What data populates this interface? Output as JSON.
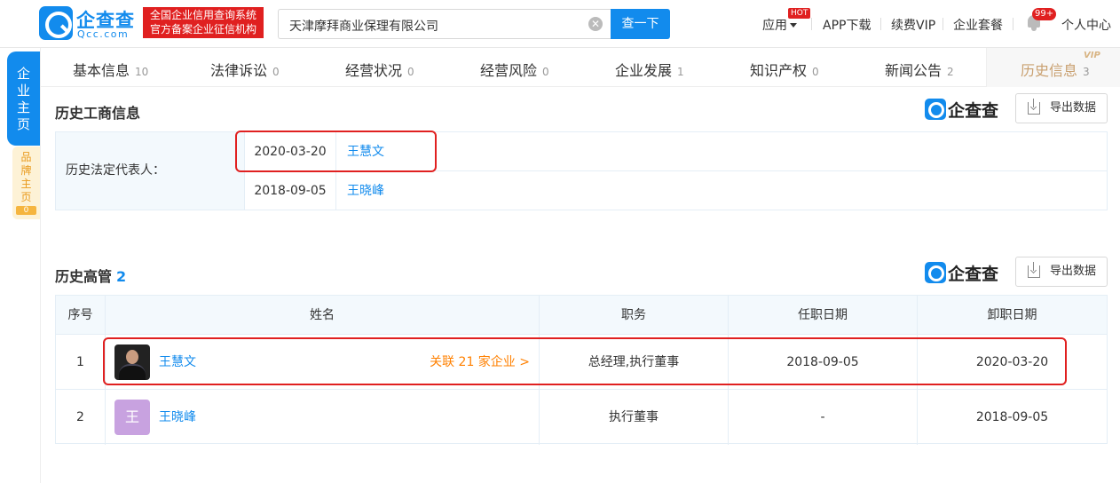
{
  "header": {
    "logo_title": "企查查",
    "logo_sub": "Qcc.com",
    "slogan_line1": "全国企业信用查询系统",
    "slogan_line2": "官方备案企业征信机构",
    "search_value": "天津摩拜商业保理有限公司",
    "search_button": "查一下",
    "nav": {
      "apps": "应用",
      "hot": "HOT",
      "app_download": "APP下载",
      "vip": "续费VIP",
      "package": "企业套餐",
      "notify_count": "99+",
      "user_center": "个人中心"
    }
  },
  "side": {
    "home": [
      "企",
      "业",
      "主",
      "页"
    ],
    "brand": [
      "品",
      "牌",
      "主",
      "页"
    ],
    "brand_count": "0"
  },
  "tabs": [
    {
      "label": "基本信息",
      "count": "10"
    },
    {
      "label": "法律诉讼",
      "count": "0"
    },
    {
      "label": "经营状况",
      "count": "0"
    },
    {
      "label": "经营风险",
      "count": "0"
    },
    {
      "label": "企业发展",
      "count": "1"
    },
    {
      "label": "知识产权",
      "count": "0"
    },
    {
      "label": "新闻公告",
      "count": "2"
    },
    {
      "label": "历史信息",
      "count": "3"
    }
  ],
  "vip_tag": "VIP",
  "section1": {
    "title": "历史工商信息",
    "export": "导出数据",
    "brand": "企查查",
    "label": "历史法定代表人：",
    "rows": [
      {
        "date": "2020-03-20",
        "name": "王慧文"
      },
      {
        "date": "2018-09-05",
        "name": "王晓峰"
      }
    ]
  },
  "section2": {
    "title": "历史高管",
    "count": "2",
    "export": "导出数据",
    "brand": "企查查",
    "columns": [
      "序号",
      "姓名",
      "职务",
      "任职日期",
      "卸职日期"
    ],
    "rows": [
      {
        "no": "1",
        "name": "王慧文",
        "related": "关联 21 家企业 >",
        "role": "总经理,执行董事",
        "start": "2018-09-05",
        "end": "2020-03-20",
        "avatar": "photo"
      },
      {
        "no": "2",
        "name": "王晓峰",
        "avatar_letter": "王",
        "role": "执行董事",
        "start": "-",
        "end": "2018-09-05"
      }
    ]
  }
}
